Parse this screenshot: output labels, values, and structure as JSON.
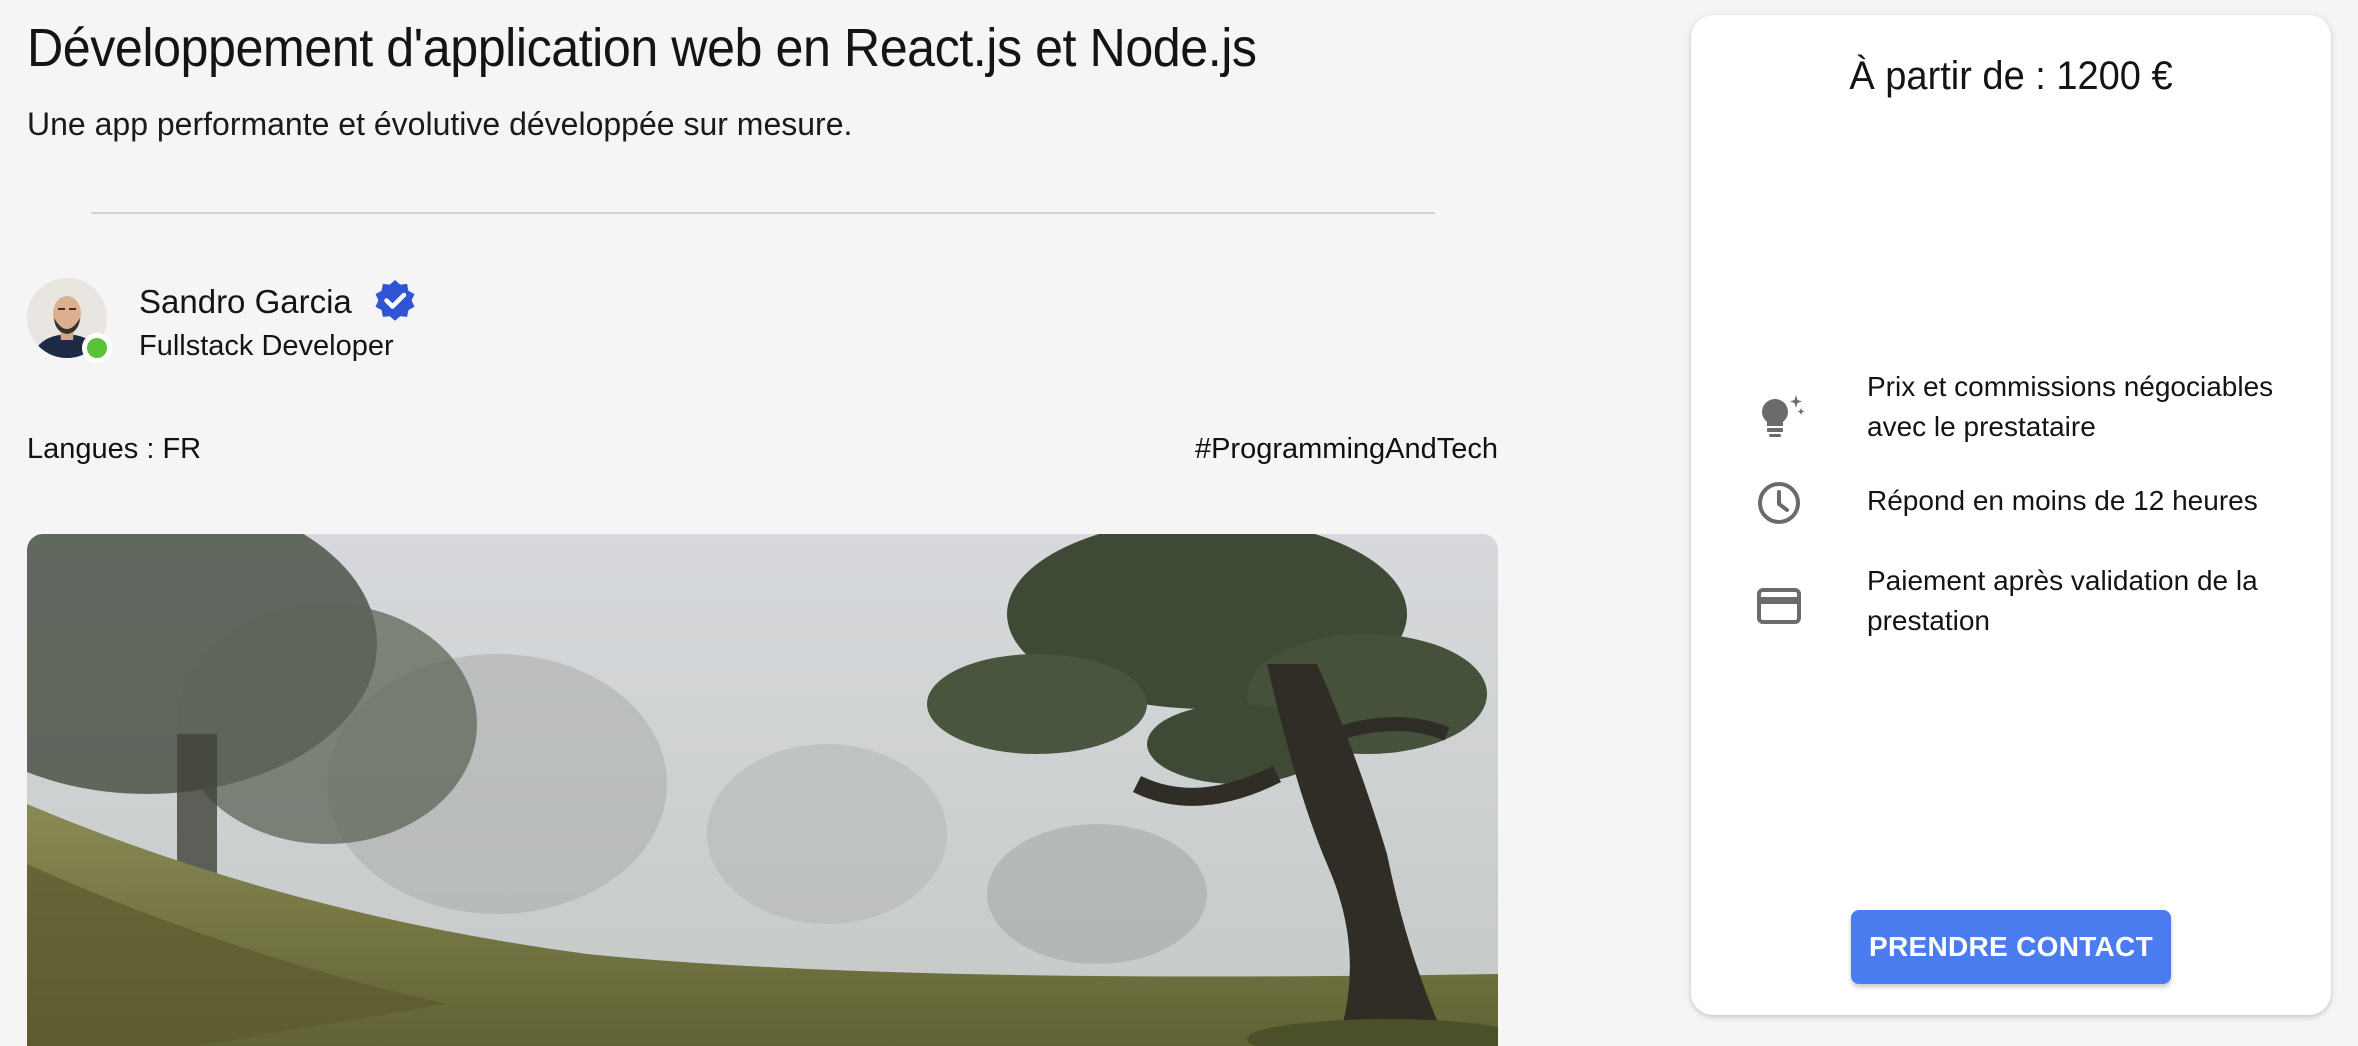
{
  "service": {
    "title": "Développement d'application web en React.js et Node.js",
    "subtitle": "Une app performante et évolutive développée sur mesure."
  },
  "author": {
    "name": "Sandro Garcia",
    "role": "Fullstack Developer",
    "online": true,
    "verified": true,
    "status_color": "#5ac13a",
    "badge_color": "#2f55d4"
  },
  "meta": {
    "languages": "Langues : FR",
    "tag": "#ProgrammingAndTech"
  },
  "cover": {
    "icon": "landscape-photo"
  },
  "pricing_card": {
    "price": "À partir de : 1200 €",
    "features": [
      {
        "icon": "lightbulb-sparkle-icon",
        "text": "Prix et commissions négociables avec le prestataire"
      },
      {
        "icon": "clock-icon",
        "text": "Répond en moins de 12 heures"
      },
      {
        "icon": "credit-card-icon",
        "text": "Paiement après validation de la prestation"
      }
    ],
    "cta_label": "PRENDRE CONTACT",
    "accent_color": "#4a7cf0"
  }
}
